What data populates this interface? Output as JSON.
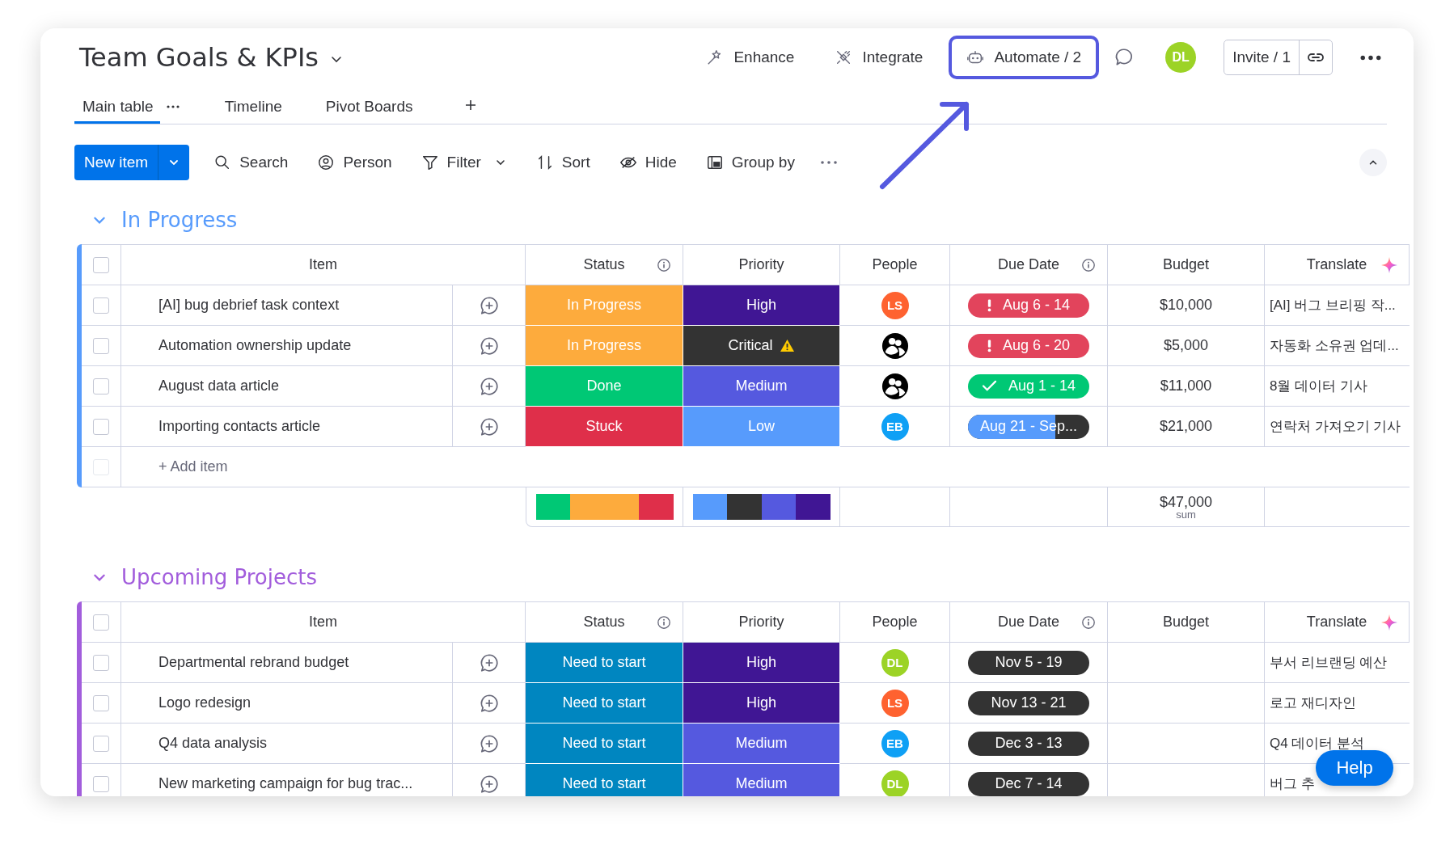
{
  "board": {
    "title": "Team Goals & KPIs"
  },
  "header_actions": [
    {
      "label": "Enhance",
      "highlighted": false
    },
    {
      "label": "Integrate",
      "highlighted": false
    },
    {
      "label": "Automate / 2",
      "highlighted": true
    }
  ],
  "avatar": {
    "initials": "DL",
    "color": "#9cd326"
  },
  "invite": {
    "label": "Invite / 1"
  },
  "tabs": [
    {
      "label": "Main table",
      "selected": true
    },
    {
      "label": "Timeline",
      "selected": false
    },
    {
      "label": "Pivot Boards",
      "selected": false
    }
  ],
  "toolbar": {
    "new_item": "New item",
    "tools": [
      {
        "label": "Search"
      },
      {
        "label": "Person"
      },
      {
        "label": "Filter"
      },
      {
        "label": "Sort"
      },
      {
        "label": "Hide"
      },
      {
        "label": "Group by"
      }
    ]
  },
  "groups": [
    {
      "title": "In Progress",
      "color": "#579bfc",
      "all_checked": false,
      "columns": [
        {
          "label": "Item"
        },
        {
          "label": "Status"
        },
        {
          "label": "Priority"
        },
        {
          "label": "People"
        },
        {
          "label": "Due Date"
        },
        {
          "label": "Budget"
        },
        {
          "label": "Translate"
        }
      ],
      "rows": [
        {
          "checked": false,
          "item": "[AI] bug debrief task context",
          "status": {
            "label": "In Progress",
            "color": "#fdab3d"
          },
          "priority": {
            "label": "High",
            "color": "#401694",
            "warning": false
          },
          "people": {
            "kind": "initials",
            "text": "LS",
            "color": "#fe6230"
          },
          "due": {
            "text": "Aug 6 - 14",
            "kind": "overdue"
          },
          "budget": "$10,000",
          "translate": "[AI] 버그 브리핑 작..."
        },
        {
          "checked": false,
          "item": "Automation ownership update",
          "status": {
            "label": "In Progress",
            "color": "#fdab3d"
          },
          "priority": {
            "label": "Critical",
            "color": "#333333",
            "warning": true
          },
          "people": {
            "kind": "unassigned"
          },
          "due": {
            "text": "Aug 6 - 20",
            "kind": "overdue"
          },
          "budget": "$5,000",
          "translate": "자동화 소유권 업데..."
        },
        {
          "checked": false,
          "item": "August data article",
          "status": {
            "label": "Done",
            "color": "#00c875"
          },
          "priority": {
            "label": "Medium",
            "color": "#5559df",
            "warning": false
          },
          "people": {
            "kind": "unassigned"
          },
          "due": {
            "text": "Aug 1 - 14",
            "kind": "done"
          },
          "budget": "$11,000",
          "translate": "8월 데이터 기사"
        },
        {
          "checked": false,
          "item": "Importing contacts article",
          "status": {
            "label": "Stuck",
            "color": "#df2f4a"
          },
          "priority": {
            "label": "Low",
            "color": "#579bfc",
            "warning": false
          },
          "people": {
            "kind": "initials",
            "text": "EB",
            "color": "#0fa0f5"
          },
          "due": {
            "text": "Aug 21 - Sep...",
            "kind": "progress",
            "level": 0.72
          },
          "budget": "$21,000",
          "translate": "연락처 가져오기 기사"
        }
      ],
      "add_item": {
        "label": "+ Add item",
        "checkbox_disabled": true
      },
      "summary": {
        "status": [
          {
            "color": "#00c875"
          },
          {
            "color": "#fdab3d"
          },
          {
            "color": "#fdab3d"
          },
          {
            "color": "#df2f4a"
          }
        ],
        "priority": [
          {
            "color": "#579bfc"
          },
          {
            "color": "#333333"
          },
          {
            "color": "#5559df"
          },
          {
            "color": "#401694"
          }
        ],
        "budget": "$47,000",
        "budget_caption": "sum"
      }
    },
    {
      "title": "Upcoming Projects",
      "color": "#a25ddc",
      "all_checked": false,
      "columns": [
        {
          "label": "Item"
        },
        {
          "label": "Status"
        },
        {
          "label": "Priority"
        },
        {
          "label": "People"
        },
        {
          "label": "Due Date"
        },
        {
          "label": "Budget"
        },
        {
          "label": "Translate"
        }
      ],
      "rows": [
        {
          "checked": false,
          "item": "Departmental rebrand budget",
          "status": {
            "label": "Need to start",
            "color": "#0086c0"
          },
          "priority": {
            "label": "High",
            "color": "#401694",
            "warning": false
          },
          "people": {
            "kind": "initials",
            "text": "DL",
            "color": "#9cd326"
          },
          "due": {
            "text": "Nov 5 - 19",
            "kind": "future"
          },
          "translate": "부서 리브랜딩 예산"
        },
        {
          "checked": false,
          "item": "Logo redesign",
          "status": {
            "label": "Need to start",
            "color": "#0086c0"
          },
          "priority": {
            "label": "High",
            "color": "#401694",
            "warning": false
          },
          "people": {
            "kind": "initials",
            "text": "LS",
            "color": "#fe6230"
          },
          "due": {
            "text": "Nov 13 - 21",
            "kind": "future"
          },
          "translate": "로고 재디자인"
        },
        {
          "checked": false,
          "item": "Q4 data analysis",
          "status": {
            "label": "Need to start",
            "color": "#0086c0"
          },
          "priority": {
            "label": "Medium",
            "color": "#5559df",
            "warning": false
          },
          "people": {
            "kind": "initials",
            "text": "EB",
            "color": "#0fa0f5"
          },
          "due": {
            "text": "Dec 3 - 13",
            "kind": "future"
          },
          "translate": "Q4 데이터 분석"
        },
        {
          "checked": false,
          "item": "New marketing campaign for bug trac...",
          "status": {
            "label": "Need to start",
            "color": "#0086c0"
          },
          "priority": {
            "label": "Medium",
            "color": "#5559df",
            "warning": false
          },
          "people": {
            "kind": "initials",
            "text": "DL",
            "color": "#9cd326"
          },
          "due": {
            "text": "Dec 7 - 14",
            "kind": "future"
          },
          "translate": "버그 추"
        }
      ]
    }
  ],
  "help": "Help"
}
